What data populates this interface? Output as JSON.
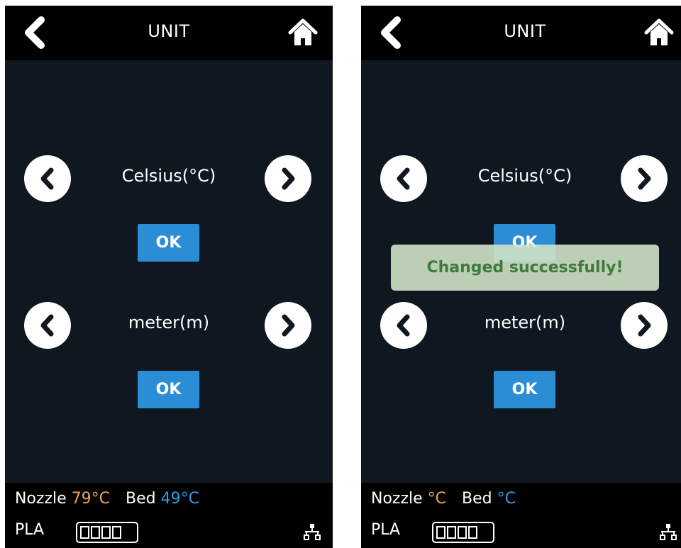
{
  "screens": [
    {
      "title": "UNIT",
      "temperature_unit": "Celsius(°C)",
      "length_unit": "meter(m)",
      "ok_label": "OK",
      "status": {
        "nozzle_label": "Nozzle",
        "nozzle_temp": "79°C",
        "bed_label": "Bed",
        "bed_temp": "49°C",
        "material": "PLA"
      }
    },
    {
      "title": "UNIT",
      "temperature_unit": "Celsius(°C)",
      "length_unit": "meter(m)",
      "ok_label": "OK",
      "toast": "Changed successfully!",
      "status": {
        "nozzle_label": "Nozzle",
        "nozzle_temp": "°C",
        "bed_label": "Bed",
        "bed_temp": "°C",
        "material": "PLA"
      }
    }
  ],
  "icons": {
    "back": "back-chevron-icon",
    "home": "home-icon",
    "prev": "chevron-left-icon",
    "next": "chevron-right-icon",
    "network": "network-icon",
    "filament": "filament-level-icon"
  },
  "colors": {
    "background": "#0f1720",
    "bar": "#000000",
    "ok_button": "#2b8dd6",
    "nozzle_temp": "#f0a452",
    "bed_temp": "#2f9ce4",
    "toast_bg": "#d0e2c8",
    "toast_text": "#3f7a3f"
  }
}
